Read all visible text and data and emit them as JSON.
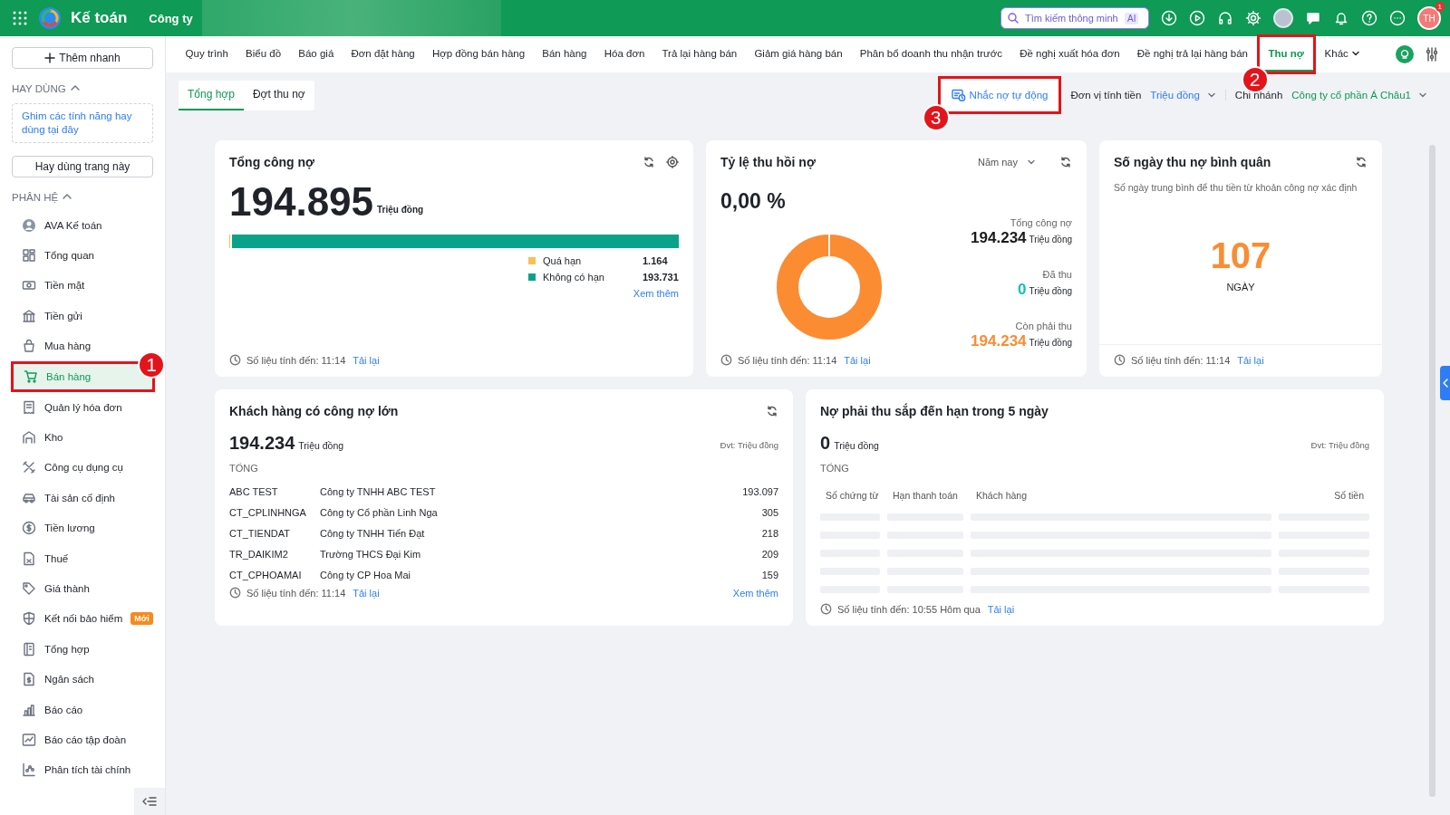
{
  "top_bar": {
    "app_title": "Kế toán",
    "company_label": "Công ty",
    "search": {
      "placeholder": "Tìm kiếm thông minh",
      "badge": "AI"
    },
    "avatar_text": "TH",
    "notification_count": "1"
  },
  "sidebar": {
    "quick_add": "Thêm nhanh",
    "favorites": {
      "title": "HAY DÙNG",
      "expanded": true,
      "hint": "Ghim các tính năng hay dùng tại đây",
      "button": "Hay dùng trang này"
    },
    "modules": {
      "title": "PHÂN HỆ",
      "expanded": true,
      "items": [
        {
          "label": "AVA Kế toán",
          "selected": false
        },
        {
          "label": "Tổng quan",
          "selected": false
        },
        {
          "label": "Tiền mặt",
          "selected": false
        },
        {
          "label": "Tiền gửi",
          "selected": false
        },
        {
          "label": "Mua hàng",
          "selected": false
        },
        {
          "label": "Bán hàng",
          "selected": true,
          "callout": "1"
        },
        {
          "label": "Quản lý hóa đơn",
          "selected": false
        },
        {
          "label": "Kho",
          "selected": false
        },
        {
          "label": "Công cụ dụng cụ",
          "selected": false
        },
        {
          "label": "Tài sản cố định",
          "selected": false
        },
        {
          "label": "Tiền lương",
          "selected": false
        },
        {
          "label": "Thuế",
          "selected": false
        },
        {
          "label": "Giá thành",
          "selected": false
        },
        {
          "label": "Kết nối bảo hiểm",
          "selected": false,
          "badge": "Mới"
        },
        {
          "label": "Tổng hợp",
          "selected": false
        },
        {
          "label": "Ngân sách",
          "selected": false
        },
        {
          "label": "Báo cáo",
          "selected": false
        },
        {
          "label": "Báo cáo tập đoàn",
          "selected": false
        },
        {
          "label": "Phân tích tài chính",
          "selected": false
        }
      ]
    }
  },
  "nav_tabs": [
    {
      "label": "Quy trình",
      "selected": false
    },
    {
      "label": "Biểu đồ",
      "selected": false
    },
    {
      "label": "Báo giá",
      "selected": false
    },
    {
      "label": "Đơn đặt hàng",
      "selected": false
    },
    {
      "label": "Hợp đồng bán hàng",
      "selected": false
    },
    {
      "label": "Bán hàng",
      "selected": false
    },
    {
      "label": "Hóa đơn",
      "selected": false
    },
    {
      "label": "Trả lại hàng bán",
      "selected": false
    },
    {
      "label": "Giảm giá hàng bán",
      "selected": false
    },
    {
      "label": "Phân bổ doanh thu nhận trước",
      "selected": false
    },
    {
      "label": "Đề nghị xuất hóa đơn",
      "selected": false
    },
    {
      "label": "Đề nghị trả lại hàng bán",
      "selected": false
    },
    {
      "label": "Thu nợ",
      "selected": true,
      "callout": "2"
    },
    {
      "label": "Khác",
      "selected": false
    }
  ],
  "sub_tabs": [
    {
      "label": "Tổng hợp",
      "selected": true
    },
    {
      "label": "Đợt thu nợ",
      "selected": false
    }
  ],
  "toolbar": {
    "auto_reminder": {
      "label": "Nhắc nợ tự động",
      "callout": "3"
    },
    "unit_label": "Đơn vị tính tiền",
    "unit_value": "Triệu đồng",
    "branch_label": "Chi nhánh",
    "branch_value": "Công ty cổ phần Á Châu1"
  },
  "total_debt": {
    "title": "Tổng công nợ",
    "amount": "194.895",
    "unit": "Triệu đồng",
    "legend": [
      {
        "label": "Quá hạn",
        "value": "1.164",
        "color": "#f8c055",
        "level": 0.006
      },
      {
        "label": "Không có hạn",
        "value": "193.731",
        "color": "#0aa38a"
      }
    ],
    "more_link": "Xem thêm",
    "updated": "Số liệu tính đến: 11:14",
    "reload": "Tải lại"
  },
  "recovery_rate": {
    "title": "Tỷ lệ thu hồi nợ",
    "period": "Năm nay",
    "rate": "0,00 %",
    "stats": [
      {
        "label": "Tổng công nợ",
        "value": "194.234",
        "unit": "Triệu đồng",
        "color": "#1b1b1b"
      },
      {
        "label": "Đã thu",
        "value": "0",
        "unit": "Triệu đồng",
        "color": "#12c2b0"
      },
      {
        "label": "Còn phải thu",
        "value": "194.234",
        "unit": "Triệu đồng",
        "color": "#fb8c32"
      }
    ],
    "updated": "Số liệu tính đến: 11:14",
    "reload": "Tải lại"
  },
  "avg_days": {
    "title": "Số ngày thu nợ bình quân",
    "description": "Số ngày trung bình để thu tiền từ khoản công nợ xác định",
    "value": "107",
    "unit": "NGÀY",
    "updated": "Số liệu tính đến: 11:14",
    "reload": "Tải lại"
  },
  "top_customers": {
    "title": "Khách hàng có công nợ lớn",
    "amount": "194.234",
    "unit": "Triệu đồng",
    "unit_note": "Đvt: Triệu đồng",
    "total_label": "TỔNG",
    "rows": [
      {
        "code": "ABC TEST",
        "name": "Công ty TNHH ABC TEST",
        "amount": "193.097"
      },
      {
        "code": "CT_CPLINHNGA",
        "name": "Công ty Cổ phần Linh Nga",
        "amount": "305"
      },
      {
        "code": "CT_TIENDAT",
        "name": "Công ty TNHH Tiến Đạt",
        "amount": "218"
      },
      {
        "code": "TR_DAIKIM2",
        "name": "Trường THCS Đại Kim",
        "amount": "209"
      },
      {
        "code": "CT_CPHOAMAI",
        "name": "Công ty CP Hoa Mai",
        "amount": "159"
      }
    ],
    "updated": "Số liệu tính đến: 11:14",
    "reload": "Tải lại",
    "more_link": "Xem thêm"
  },
  "due_soon": {
    "title": "Nợ phải thu sắp đến hạn trong 5 ngày",
    "amount": "0",
    "unit": "Triệu đồng",
    "unit_note": "Đvt: Triệu đồng",
    "total_label": "TỔNG",
    "columns": [
      "Số chứng từ",
      "Hạn thanh toán",
      "Khách hàng",
      "Số tiền"
    ],
    "loading": true,
    "updated": "Số liệu tính đến: 10:55 Hôm qua",
    "reload": "Tải lại"
  }
}
